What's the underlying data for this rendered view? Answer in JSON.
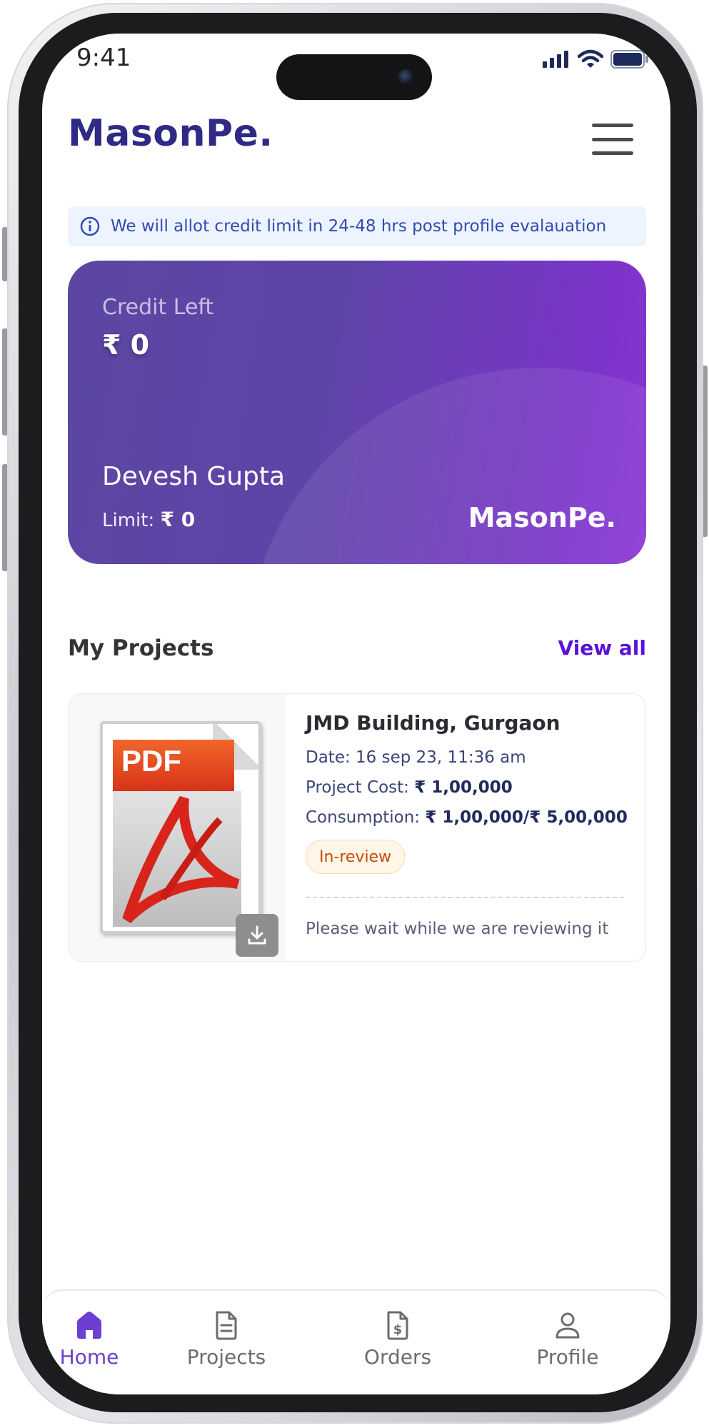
{
  "status_bar": {
    "time": "9:41"
  },
  "header": {
    "brand": "MasonPe."
  },
  "info_banner": {
    "text": "We will allot credit limit in 24-48 hrs post profile evalauation"
  },
  "credit_card": {
    "label": "Credit Left",
    "amount": "₹ 0",
    "holder_name": "Devesh Gupta",
    "limit_label": "Limit:",
    "limit_value": "₹ 0",
    "brand": "MasonPe."
  },
  "projects_section": {
    "title": "My Projects",
    "view_all": "View all"
  },
  "project": {
    "thumbnail_text": "PDF",
    "name": "JMD Building, Gurgaon",
    "date_label": "Date:",
    "date_value": "16 sep 23, 11:36 am",
    "cost_label": "Project Cost:",
    "cost_value": "₹ 1,00,000",
    "consumption_label": "Consumption:",
    "consumption_value": "₹ 1,00,000/₹ 5,00,000",
    "status": "In-review",
    "note": "Please wait while we are reviewing it"
  },
  "bottom_nav": [
    {
      "label": "Home",
      "icon": "home-icon",
      "active": true
    },
    {
      "label": "Projects",
      "icon": "document-icon",
      "active": false
    },
    {
      "label": "Orders",
      "icon": "invoice-dollar-icon",
      "active": false
    },
    {
      "label": "Profile",
      "icon": "user-icon",
      "active": false
    }
  ],
  "colors": {
    "brand": "#2e2a85",
    "accent": "#5a12d8",
    "card_gradient_start": "#5c46a2",
    "card_gradient_end": "#8a35d6",
    "status_pill_text": "#c74a08"
  }
}
